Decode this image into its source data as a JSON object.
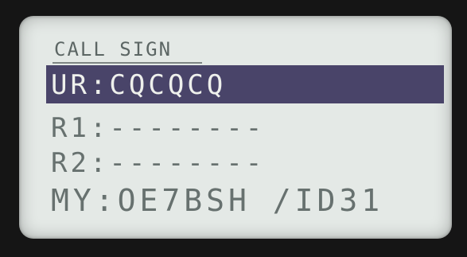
{
  "screen": {
    "title": "CALL SIGN",
    "rows": [
      {
        "label": "UR:",
        "value": "CQCQCQ",
        "selected": true
      },
      {
        "label": "R1:",
        "value": "--------",
        "selected": false
      },
      {
        "label": "R2:",
        "value": "--------",
        "selected": false
      },
      {
        "label": "MY:",
        "value": "OE7BSH /ID31",
        "selected": false
      }
    ]
  },
  "colors": {
    "lcd_background": "#e4e9e6",
    "lcd_text": "#67716f",
    "selection_bar": "#494469",
    "selected_text": "#eef0ec",
    "bezel": "#151515"
  }
}
